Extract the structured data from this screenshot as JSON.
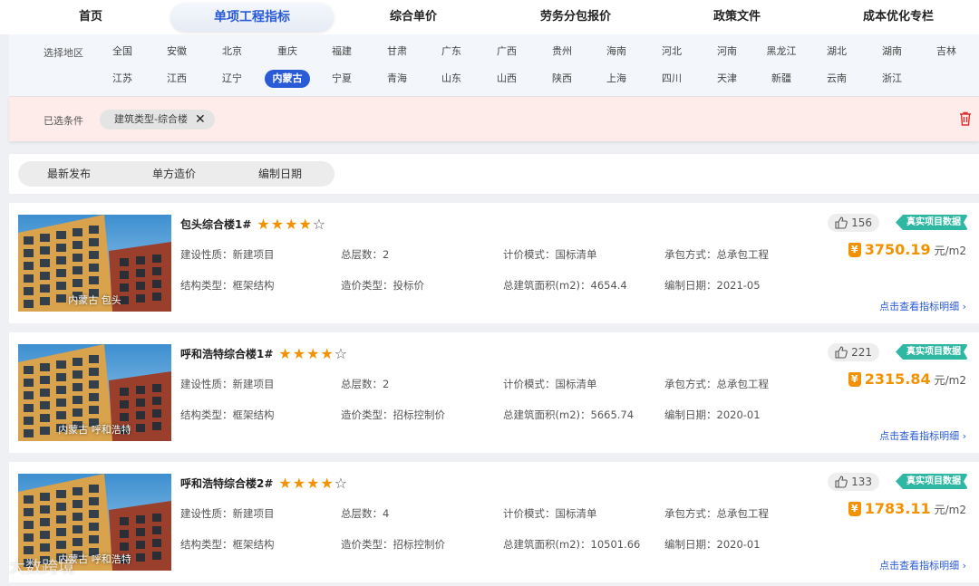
{
  "nav": {
    "tabs": [
      "首页",
      "单项工程指标",
      "综合单价",
      "劳务分包报价",
      "政策文件",
      "成本优化专栏"
    ]
  },
  "regions": {
    "label": "选择地区",
    "row1": [
      "全国",
      "安徽",
      "北京",
      "重庆",
      "福建",
      "甘肃",
      "广东",
      "广西",
      "贵州",
      "海南",
      "河北",
      "河南",
      "黑龙江",
      "湖北",
      "湖南",
      "吉林"
    ],
    "row2": [
      "江苏",
      "江西",
      "辽宁",
      "内蒙古",
      "宁夏",
      "青海",
      "山东",
      "山西",
      "陕西",
      "上海",
      "四川",
      "天津",
      "新疆",
      "云南",
      "浙江"
    ],
    "selected": "内蒙古"
  },
  "filters": {
    "label": "已选条件",
    "chip": "建筑类型-综合楼"
  },
  "sort": {
    "options": [
      "最新发布",
      "单方造价",
      "编制日期"
    ]
  },
  "labels": {
    "nature": "建设性质：",
    "floors": "总层数：",
    "pricing_mode": "计价模式：",
    "contract": "承包方式：",
    "structure": "结构类型：",
    "cost_type": "造价类型：",
    "area": "总建筑面积(m2)：",
    "date": "编制日期：",
    "unit": "元/m2",
    "detail": "点击查看指标明细",
    "badge": "真实项目数据"
  },
  "projects": [
    {
      "title": "包头综合楼1#",
      "rating": 4,
      "location": "内蒙古 包头",
      "nature": "新建项目",
      "floors": "2",
      "pricing_mode": "国标清单",
      "contract": "总承包工程",
      "structure": "框架结构",
      "cost_type": "投标价",
      "area": "4654.4",
      "date": "2021-05",
      "likes": "156",
      "price": "3750.19"
    },
    {
      "title": "呼和浩特综合楼1#",
      "rating": 4,
      "location": "内蒙古 呼和浩特",
      "nature": "新建项目",
      "floors": "2",
      "pricing_mode": "国标清单",
      "contract": "总承包工程",
      "structure": "框架结构",
      "cost_type": "招标控制价",
      "area": "5665.74",
      "date": "2020-01",
      "likes": "221",
      "price": "2315.84"
    },
    {
      "title": "呼和浩特综合楼2#",
      "rating": 4,
      "location": "内蒙古 呼和浩特",
      "nature": "新建项目",
      "floors": "4",
      "pricing_mode": "国标清单",
      "contract": "总承包工程",
      "structure": "框架结构",
      "cost_type": "招标控制价",
      "area": "10501.66",
      "date": "2020-01",
      "likes": "133",
      "price": "1783.11"
    }
  ],
  "watermark": "大数跨境",
  "colors": {
    "accent": "#2a5bd7",
    "price": "#f39200",
    "badge": "#2eb7a3",
    "filter_bg": "#fdecea",
    "delete": "#e03030"
  },
  "icons": {
    "like": "thumb-up-icon",
    "delete": "trash-icon",
    "remove_chip": "close-icon",
    "detail": "chevron-right-icon",
    "price": "yen-tag-icon"
  }
}
